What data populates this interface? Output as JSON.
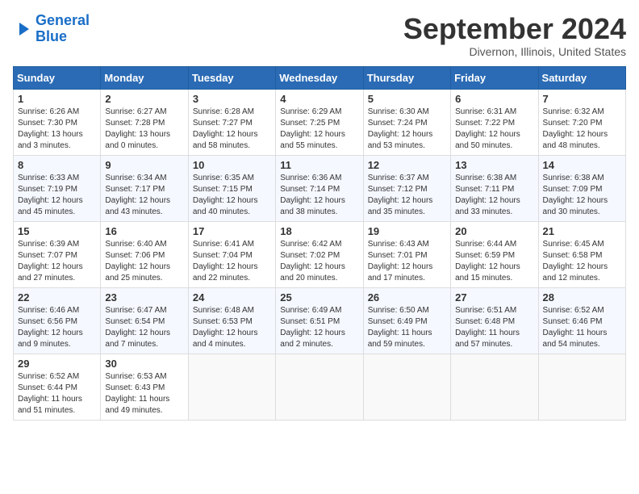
{
  "header": {
    "logo_line1": "General",
    "logo_line2": "Blue",
    "month_title": "September 2024",
    "location": "Divernon, Illinois, United States"
  },
  "weekdays": [
    "Sunday",
    "Monday",
    "Tuesday",
    "Wednesday",
    "Thursday",
    "Friday",
    "Saturday"
  ],
  "weeks": [
    [
      {
        "day": "1",
        "sunrise": "6:26 AM",
        "sunset": "7:30 PM",
        "daylight": "13 hours and 3 minutes."
      },
      {
        "day": "2",
        "sunrise": "6:27 AM",
        "sunset": "7:28 PM",
        "daylight": "13 hours and 0 minutes."
      },
      {
        "day": "3",
        "sunrise": "6:28 AM",
        "sunset": "7:27 PM",
        "daylight": "12 hours and 58 minutes."
      },
      {
        "day": "4",
        "sunrise": "6:29 AM",
        "sunset": "7:25 PM",
        "daylight": "12 hours and 55 minutes."
      },
      {
        "day": "5",
        "sunrise": "6:30 AM",
        "sunset": "7:24 PM",
        "daylight": "12 hours and 53 minutes."
      },
      {
        "day": "6",
        "sunrise": "6:31 AM",
        "sunset": "7:22 PM",
        "daylight": "12 hours and 50 minutes."
      },
      {
        "day": "7",
        "sunrise": "6:32 AM",
        "sunset": "7:20 PM",
        "daylight": "12 hours and 48 minutes."
      }
    ],
    [
      {
        "day": "8",
        "sunrise": "6:33 AM",
        "sunset": "7:19 PM",
        "daylight": "12 hours and 45 minutes."
      },
      {
        "day": "9",
        "sunrise": "6:34 AM",
        "sunset": "7:17 PM",
        "daylight": "12 hours and 43 minutes."
      },
      {
        "day": "10",
        "sunrise": "6:35 AM",
        "sunset": "7:15 PM",
        "daylight": "12 hours and 40 minutes."
      },
      {
        "day": "11",
        "sunrise": "6:36 AM",
        "sunset": "7:14 PM",
        "daylight": "12 hours and 38 minutes."
      },
      {
        "day": "12",
        "sunrise": "6:37 AM",
        "sunset": "7:12 PM",
        "daylight": "12 hours and 35 minutes."
      },
      {
        "day": "13",
        "sunrise": "6:38 AM",
        "sunset": "7:11 PM",
        "daylight": "12 hours and 33 minutes."
      },
      {
        "day": "14",
        "sunrise": "6:38 AM",
        "sunset": "7:09 PM",
        "daylight": "12 hours and 30 minutes."
      }
    ],
    [
      {
        "day": "15",
        "sunrise": "6:39 AM",
        "sunset": "7:07 PM",
        "daylight": "12 hours and 27 minutes."
      },
      {
        "day": "16",
        "sunrise": "6:40 AM",
        "sunset": "7:06 PM",
        "daylight": "12 hours and 25 minutes."
      },
      {
        "day": "17",
        "sunrise": "6:41 AM",
        "sunset": "7:04 PM",
        "daylight": "12 hours and 22 minutes."
      },
      {
        "day": "18",
        "sunrise": "6:42 AM",
        "sunset": "7:02 PM",
        "daylight": "12 hours and 20 minutes."
      },
      {
        "day": "19",
        "sunrise": "6:43 AM",
        "sunset": "7:01 PM",
        "daylight": "12 hours and 17 minutes."
      },
      {
        "day": "20",
        "sunrise": "6:44 AM",
        "sunset": "6:59 PM",
        "daylight": "12 hours and 15 minutes."
      },
      {
        "day": "21",
        "sunrise": "6:45 AM",
        "sunset": "6:58 PM",
        "daylight": "12 hours and 12 minutes."
      }
    ],
    [
      {
        "day": "22",
        "sunrise": "6:46 AM",
        "sunset": "6:56 PM",
        "daylight": "12 hours and 9 minutes."
      },
      {
        "day": "23",
        "sunrise": "6:47 AM",
        "sunset": "6:54 PM",
        "daylight": "12 hours and 7 minutes."
      },
      {
        "day": "24",
        "sunrise": "6:48 AM",
        "sunset": "6:53 PM",
        "daylight": "12 hours and 4 minutes."
      },
      {
        "day": "25",
        "sunrise": "6:49 AM",
        "sunset": "6:51 PM",
        "daylight": "12 hours and 2 minutes."
      },
      {
        "day": "26",
        "sunrise": "6:50 AM",
        "sunset": "6:49 PM",
        "daylight": "11 hours and 59 minutes."
      },
      {
        "day": "27",
        "sunrise": "6:51 AM",
        "sunset": "6:48 PM",
        "daylight": "11 hours and 57 minutes."
      },
      {
        "day": "28",
        "sunrise": "6:52 AM",
        "sunset": "6:46 PM",
        "daylight": "11 hours and 54 minutes."
      }
    ],
    [
      {
        "day": "29",
        "sunrise": "6:52 AM",
        "sunset": "6:44 PM",
        "daylight": "11 hours and 51 minutes."
      },
      {
        "day": "30",
        "sunrise": "6:53 AM",
        "sunset": "6:43 PM",
        "daylight": "11 hours and 49 minutes."
      },
      null,
      null,
      null,
      null,
      null
    ]
  ]
}
